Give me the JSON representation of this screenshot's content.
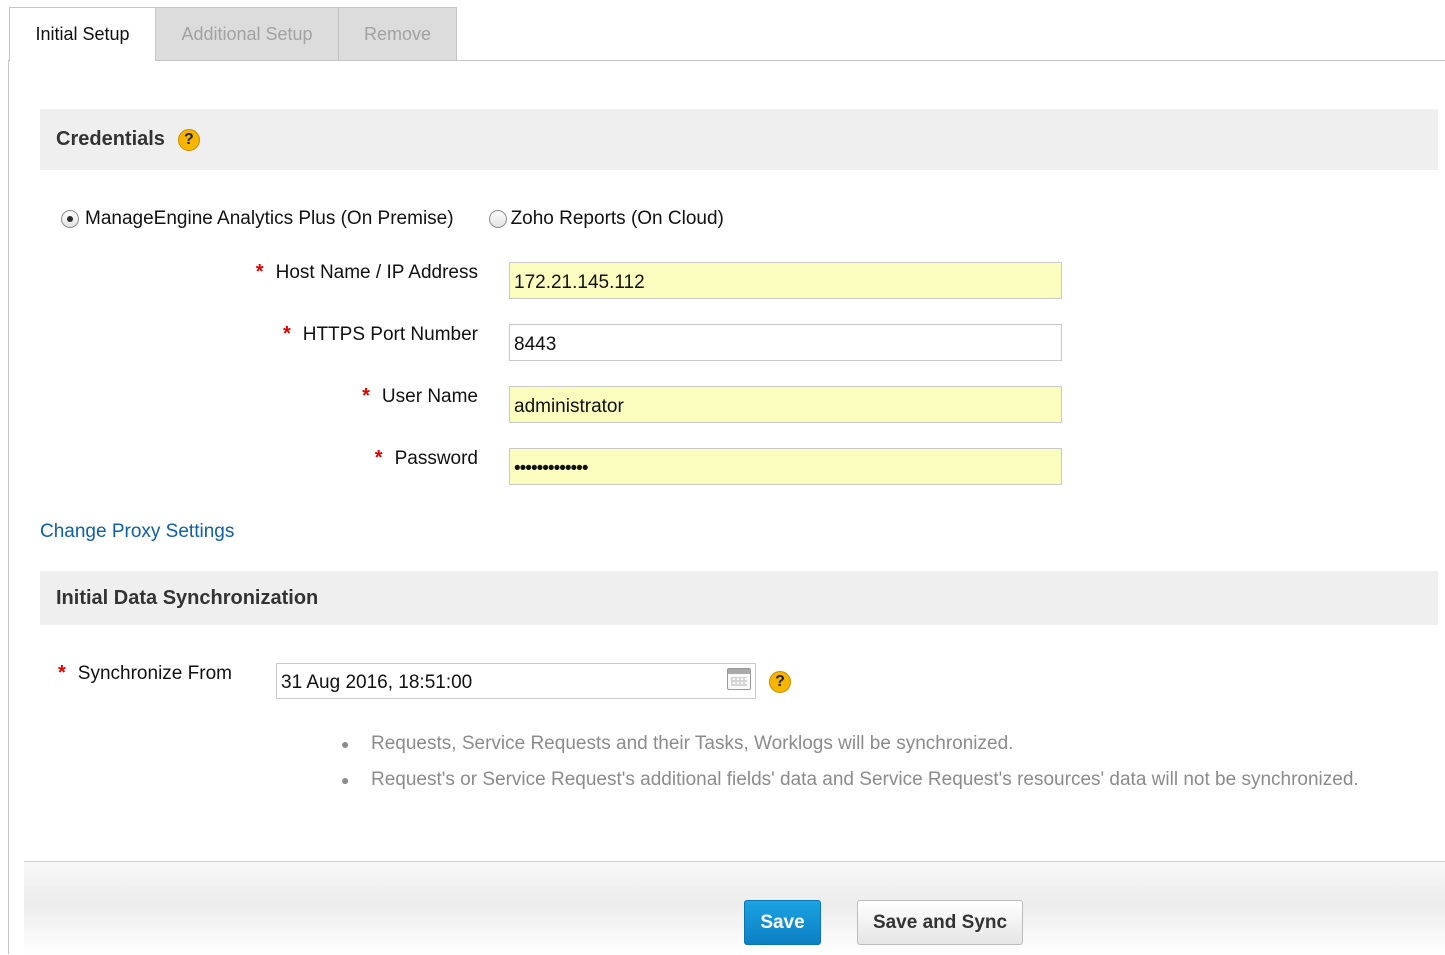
{
  "tabs": [
    {
      "label": "Initial Setup"
    },
    {
      "label": "Additional Setup"
    },
    {
      "label": "Remove"
    }
  ],
  "credentials": {
    "title": "Credentials",
    "help_icon": "question-icon",
    "options": [
      {
        "label": "ManageEngine Analytics Plus (On Premise)",
        "selected": true
      },
      {
        "label": "Zoho Reports (On Cloud)",
        "selected": false
      }
    ],
    "required_mark": "*",
    "fields": {
      "host": {
        "label": "Host Name / IP Address",
        "value": "172.21.145.112"
      },
      "port": {
        "label": "HTTPS Port Number",
        "value": "8443"
      },
      "username": {
        "label": "User Name",
        "value": "administrator"
      },
      "password": {
        "label": "Password",
        "value": "•••••••••••••"
      }
    }
  },
  "proxy_link": "Change Proxy Settings",
  "sync": {
    "title": "Initial Data Synchronization",
    "from_label": "Synchronize From",
    "from_value": "31 Aug 2016, 18:51:00",
    "calendar_icon": "calendar-icon",
    "notes": [
      "Requests, Service Requests and their Tasks, Worklogs will be synchronized.",
      "Request's or Service Request's additional fields' data and Service Request's resources' data will not be synchronized."
    ]
  },
  "buttons": {
    "save": "Save",
    "save_sync": "Save and Sync"
  },
  "colors": {
    "accent": "#0d7fc3",
    "link": "#0e5fa3",
    "required": "#e00000",
    "autofill": "#fbfdbf"
  }
}
